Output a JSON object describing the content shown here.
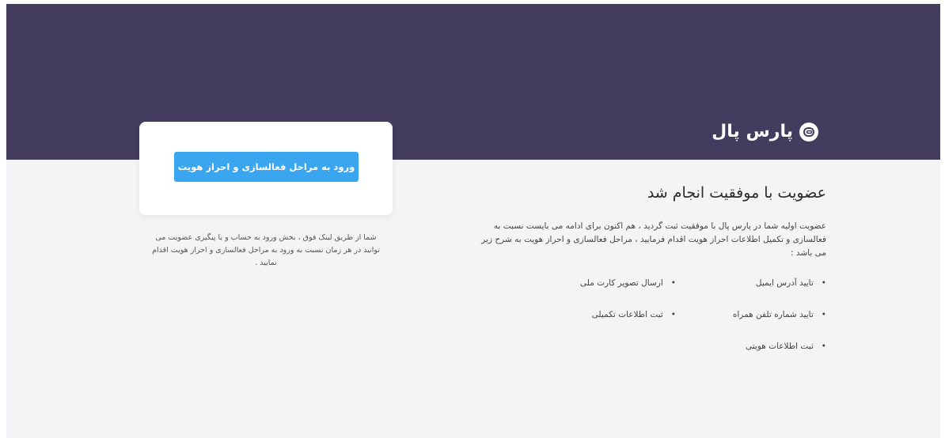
{
  "header": {
    "logo_text": "پارس پال",
    "logo_icon": "parspal-logo-icon",
    "colors": {
      "hero_bg": "#433c5e",
      "accent": "#3aa6ef"
    }
  },
  "card": {
    "button_label": "ورود به مراحل فعالسازی و احراز هویت",
    "note": "شما از طریق لینک فوق ، بخش ورود به حساب و یا پیگیری عضویت می توانید در هر زمان نسبت به ورود به مراحل فعالسازی و احراز هویت اقدام نمایید ."
  },
  "main": {
    "title": "عضویت با موفقیت انجام شد",
    "description": "عضویت اولیه شما در پارس پال با موفقیت ثبت گردید ، هم اکنون برای ادامه می بایست نسبت به فعالسازی و تکمیل اطلاعات احراز هویت اقدام فرمایید ، مراحل فعالسازی و احراز هویت به شرح زیر می باشد :",
    "steps": [
      "تایید آدرس ایمیل",
      "ارسال تصویر کارت ملی",
      "تایید شماره تلفن همراه",
      "ثبت اطلاعات تکمیلی",
      "ثبت اطلاعات هویتی"
    ]
  }
}
